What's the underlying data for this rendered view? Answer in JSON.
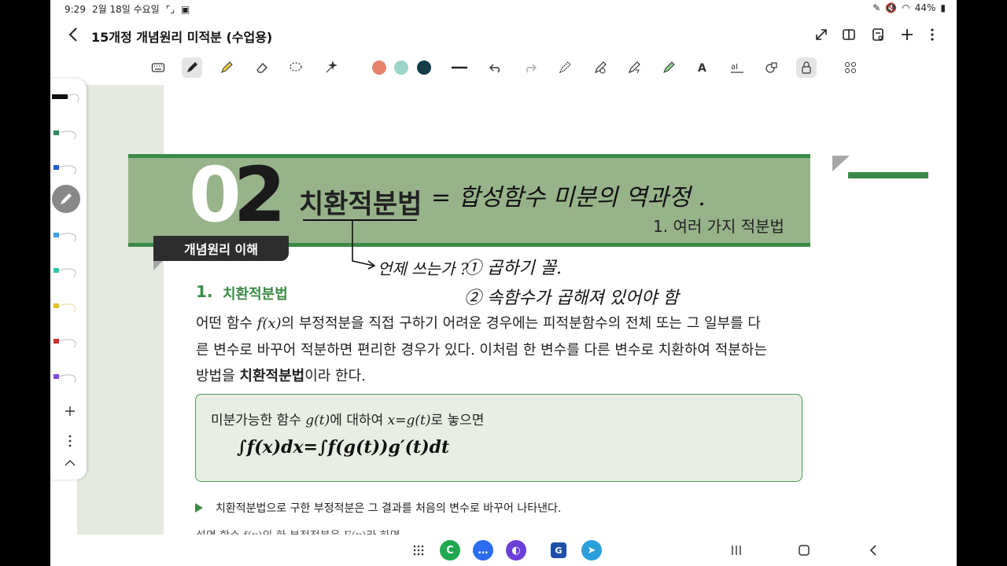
{
  "status": {
    "time": "9:29",
    "date": "2월 18일 수요일",
    "battery": "44%"
  },
  "title_bar": {
    "title": "15개정 개념원리 미적분 (수업용)",
    "icons": [
      "back-arrow-icon",
      "expand-icon",
      "book-icon",
      "page-settings-icon",
      "plus-icon",
      "more-icon"
    ]
  },
  "toolbar": {
    "tools": [
      "keyboard-icon",
      "pen-icon",
      "highlighter-icon",
      "eraser-icon",
      "lasso-icon",
      "magic-icon",
      "undo-icon",
      "redo-icon",
      "pen-settings-icon",
      "shape-pen-icon",
      "pencil-arrow-icon",
      "marker-icon",
      "text-icon",
      "text-box-icon",
      "shapes-icon",
      "lock-icon",
      "grid-icon"
    ],
    "colors": [
      "#e5836c",
      "#9dd4c9",
      "#123c47"
    ]
  },
  "pen_rail": {
    "pen_colors": [
      "#111111",
      "#2e8b57",
      "#1e5bd1",
      "#b22222",
      "#3aa0e0",
      "#2fc4a8",
      "#e6c02a",
      "#d42b2b",
      "#7a4be0"
    ]
  },
  "document": {
    "chapter_number_light": "0",
    "chapter_number_dark": "2",
    "chapter_title": "치환적분법",
    "subtitle": "1. 여러 가지 적분법",
    "tag": "개념원리 이해",
    "section_number": "1.",
    "section_title": "치환적분법",
    "para_line1_a": "어떤 함수 ",
    "para_line1_fx": "f(x)",
    "para_line1_b": "의 부정적분을 직접 구하기 어려운 경우에는 피적분함수의 전체 또는 그 일부를 다",
    "para_line2": "른 변수로 바꾸어 적분하면 편리한 경우가 있다. 이처럼 한 변수를 다른 변수로 치환하여 적분하는",
    "para_line3_a": "방법을 ",
    "para_line3_bold": "치환적분법",
    "para_line3_b": "이라 한다.",
    "box_line_a": "미분가능한 함수 ",
    "box_line_g": "g(t)",
    "box_line_b": "에 대하여 ",
    "box_line_x": "x=g(t)",
    "box_line_c": "로 놓으면",
    "box_formula": "∫f(x)dx=∫f(g(t))g′(t)dt",
    "note": "치환적분법으로 구한 부정적분은 그 결과를 처음의 변수로 바꾸어 나타낸다.",
    "cut_line": "설명  함수 f(x)의 한 부정적분을 F(x)라 하면"
  },
  "handwriting": {
    "equation": "= 합성함수 미분의 역과정 .",
    "q": "언제 쓰는가 ?",
    "item1": "① 곱하기 꼴.",
    "item2": "② 속함수가 곱해져 있어야 함"
  },
  "navbar": {
    "apps": [
      "apps-grid-icon",
      "c-app-icon",
      "messages-icon",
      "internet-icon",
      "g-app-icon",
      "telegram-icon"
    ],
    "buttons": [
      "recents-icon",
      "home-icon",
      "back-icon"
    ]
  }
}
